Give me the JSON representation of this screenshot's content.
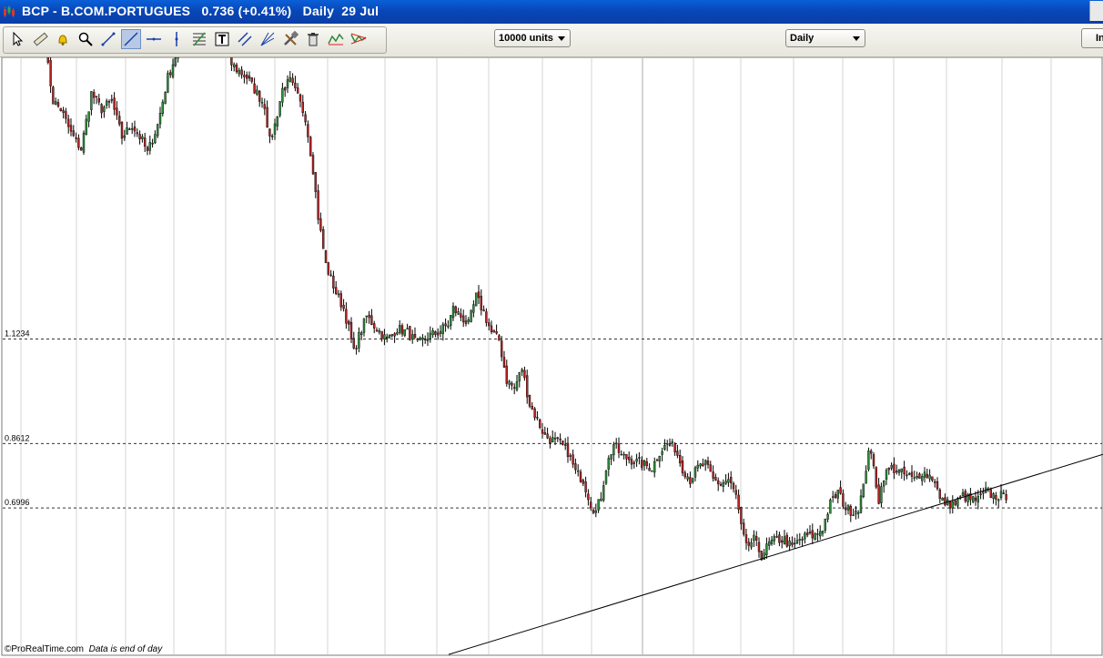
{
  "window": {
    "title": "BCP - B.COM.PORTUGUES   0.736 (+0.41%)   Daily  29 Jul"
  },
  "toolbar": {
    "tools": [
      {
        "icon": "pointer-icon"
      },
      {
        "icon": "ruler-icon"
      },
      {
        "icon": "alert-bell-icon"
      },
      {
        "icon": "zoom-icon"
      },
      {
        "icon": "line-tool-icon"
      },
      {
        "icon": "trendline-tool-icon"
      },
      {
        "icon": "horizontal-line-icon"
      },
      {
        "icon": "vertical-line-icon"
      },
      {
        "icon": "fibonacci-icon"
      },
      {
        "icon": "text-tool-icon"
      },
      {
        "icon": "parallel-channel-icon"
      },
      {
        "icon": "fan-icon"
      },
      {
        "icon": "tools-icon"
      },
      {
        "icon": "trash-icon"
      },
      {
        "icon": "pattern-icon"
      },
      {
        "icon": "triangle-pattern-icon"
      }
    ],
    "units_select": "10000 units",
    "period_select": "Daily",
    "right_button": "In"
  },
  "footer": {
    "copyright": "©ProRealTime.com",
    "note": "Data is end of day"
  },
  "colors": {
    "titlebar": "#0a50c8",
    "up_candle": "#2e8b3a",
    "down_candle": "#b22222",
    "grid": "#d4d4d4"
  },
  "chart_data": {
    "type": "candlestick",
    "symbol": "BCP",
    "period": "Daily",
    "last_price": 0.736,
    "change_pct": 0.41,
    "ylim": [
      0.33,
      1.83
    ],
    "grid": true,
    "levels": [
      {
        "value": 1.1234,
        "label": "1.1234"
      },
      {
        "value": 0.8612,
        "label": "0.8612"
      },
      {
        "value": 0.6996,
        "label": "0.6996"
      }
    ],
    "trendline": {
      "start": {
        "bar": 0,
        "price": 0.332
      },
      "end": {
        "bar": 215,
        "price": 0.834
      }
    },
    "trendline_origin_bar": 485,
    "path": [
      [
        0,
        1.85
      ],
      [
        3,
        1.72
      ],
      [
        6,
        1.7
      ],
      [
        10,
        1.64
      ],
      [
        14,
        1.6
      ],
      [
        18,
        1.74
      ],
      [
        22,
        1.7
      ],
      [
        26,
        1.72
      ],
      [
        30,
        1.63
      ],
      [
        34,
        1.66
      ],
      [
        38,
        1.62
      ],
      [
        40,
        1.59
      ],
      [
        44,
        1.66
      ],
      [
        48,
        1.78
      ],
      [
        52,
        1.85
      ],
      [
        56,
        1.95
      ],
      [
        62,
        1.92
      ],
      [
        66,
        1.95
      ],
      [
        70,
        1.86
      ],
      [
        72,
        1.82
      ],
      [
        75,
        1.8
      ],
      [
        79,
        1.78
      ],
      [
        83,
        1.74
      ],
      [
        86,
        1.71
      ],
      [
        88,
        1.62
      ],
      [
        90,
        1.66
      ],
      [
        93,
        1.75
      ],
      [
        96,
        1.77
      ],
      [
        99,
        1.73
      ],
      [
        102,
        1.68
      ],
      [
        105,
        1.55
      ],
      [
        107,
        1.43
      ],
      [
        110,
        1.31
      ],
      [
        114,
        1.24
      ],
      [
        117,
        1.2
      ],
      [
        119,
        1.15
      ],
      [
        121,
        1.09
      ],
      [
        123,
        1.13
      ],
      [
        126,
        1.18
      ],
      [
        130,
        1.15
      ],
      [
        134,
        1.12
      ],
      [
        138,
        1.15
      ],
      [
        142,
        1.14
      ],
      [
        146,
        1.11
      ],
      [
        150,
        1.13
      ],
      [
        154,
        1.14
      ],
      [
        158,
        1.16
      ],
      [
        160,
        1.2
      ],
      [
        163,
        1.18
      ],
      [
        166,
        1.16
      ],
      [
        169,
        1.23
      ],
      [
        172,
        1.19
      ],
      [
        175,
        1.14
      ],
      [
        178,
        1.12
      ],
      [
        181,
        1.02
      ],
      [
        184,
        1.0
      ],
      [
        187,
        1.05
      ],
      [
        190,
        0.96
      ],
      [
        193,
        0.92
      ],
      [
        196,
        0.88
      ],
      [
        199,
        0.87
      ],
      [
        202,
        0.86
      ],
      [
        205,
        0.84
      ],
      [
        208,
        0.79
      ],
      [
        211,
        0.77
      ],
      [
        214,
        0.71
      ],
      [
        216,
        0.69
      ],
      [
        218,
        0.73
      ],
      [
        220,
        0.8
      ],
      [
        223,
        0.86
      ],
      [
        226,
        0.83
      ],
      [
        230,
        0.82
      ],
      [
        234,
        0.81
      ],
      [
        238,
        0.8
      ],
      [
        241,
        0.84
      ],
      [
        244,
        0.86
      ],
      [
        247,
        0.85
      ],
      [
        250,
        0.8
      ],
      [
        253,
        0.77
      ],
      [
        256,
        0.8
      ],
      [
        259,
        0.81
      ],
      [
        262,
        0.77
      ],
      [
        265,
        0.76
      ],
      [
        268,
        0.77
      ],
      [
        271,
        0.73
      ],
      [
        273,
        0.65
      ],
      [
        275,
        0.6
      ],
      [
        278,
        0.62
      ],
      [
        281,
        0.58
      ],
      [
        284,
        0.61
      ],
      [
        287,
        0.62
      ],
      [
        290,
        0.62
      ],
      [
        293,
        0.6
      ],
      [
        296,
        0.62
      ],
      [
        299,
        0.63
      ],
      [
        302,
        0.63
      ],
      [
        305,
        0.65
      ],
      [
        308,
        0.71
      ],
      [
        311,
        0.74
      ],
      [
        314,
        0.7
      ],
      [
        317,
        0.69
      ],
      [
        319,
        0.7
      ],
      [
        321,
        0.75
      ],
      [
        323,
        0.85
      ],
      [
        325,
        0.8
      ],
      [
        327,
        0.72
      ],
      [
        329,
        0.78
      ],
      [
        332,
        0.8
      ],
      [
        335,
        0.79
      ],
      [
        338,
        0.78
      ],
      [
        341,
        0.77
      ],
      [
        344,
        0.79
      ],
      [
        347,
        0.78
      ],
      [
        349,
        0.77
      ],
      [
        351,
        0.72
      ],
      [
        354,
        0.71
      ],
      [
        357,
        0.71
      ],
      [
        360,
        0.73
      ],
      [
        363,
        0.72
      ],
      [
        366,
        0.72
      ],
      [
        369,
        0.74
      ],
      [
        372,
        0.73
      ],
      [
        375,
        0.73
      ],
      [
        377,
        0.72
      ]
    ]
  }
}
